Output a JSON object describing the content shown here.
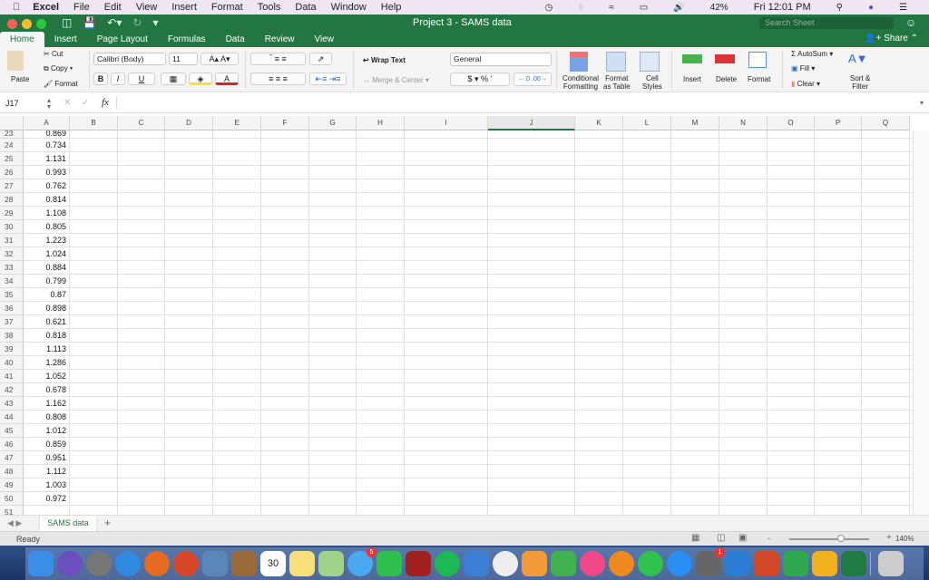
{
  "menubar": {
    "app": "Excel",
    "items": [
      "File",
      "Edit",
      "View",
      "Insert",
      "Format",
      "Tools",
      "Data",
      "Window",
      "Help"
    ],
    "battery": "42%",
    "clock": "Fri 12:01 PM"
  },
  "window": {
    "title": "Project 3 - SAMS data",
    "search_placeholder": "Search Sheet",
    "share": "Share"
  },
  "tabs": [
    "Home",
    "Insert",
    "Page Layout",
    "Formulas",
    "Data",
    "Review",
    "View"
  ],
  "ribbon": {
    "paste": "Paste",
    "cut": "Cut",
    "copy": "Copy",
    "format_painter": "Format",
    "font": "Calibri (Body)",
    "size": "11",
    "bold": "B",
    "italic": "I",
    "underline": "U",
    "wrap": "Wrap Text",
    "merge": "Merge & Center",
    "number_format": "General",
    "currency": "$",
    "percent": "%",
    "comma": "’",
    "cond": [
      "Conditional",
      "Formatting"
    ],
    "fmt_table": [
      "Format",
      "as Table"
    ],
    "cell_styles": [
      "Cell",
      "Styles"
    ],
    "insert": "Insert",
    "delete": "Delete",
    "format": "Format",
    "autosum": "AutoSum",
    "fill": "Fill",
    "clear": "Clear",
    "sort": [
      "Sort &",
      "Filter"
    ]
  },
  "formula_bar": {
    "name_box": "J17",
    "fx": "fx",
    "value": ""
  },
  "grid": {
    "columns": [
      "A",
      "B",
      "C",
      "D",
      "E",
      "F",
      "G",
      "H",
      "I",
      "J",
      "K",
      "L",
      "M",
      "N",
      "O",
      "P",
      "Q"
    ],
    "selected_column": "J",
    "rows": [
      {
        "n": "23",
        "a": "0.869"
      },
      {
        "n": "24",
        "a": "0.734"
      },
      {
        "n": "25",
        "a": "1.131"
      },
      {
        "n": "26",
        "a": "0.993"
      },
      {
        "n": "27",
        "a": "0.762"
      },
      {
        "n": "28",
        "a": "0.814"
      },
      {
        "n": "29",
        "a": "1.108"
      },
      {
        "n": "30",
        "a": "0.805"
      },
      {
        "n": "31",
        "a": "1.223"
      },
      {
        "n": "32",
        "a": "1.024"
      },
      {
        "n": "33",
        "a": "0.884"
      },
      {
        "n": "34",
        "a": "0.799"
      },
      {
        "n": "35",
        "a": "0.87"
      },
      {
        "n": "36",
        "a": "0.898"
      },
      {
        "n": "37",
        "a": "0.621"
      },
      {
        "n": "38",
        "a": "0.818"
      },
      {
        "n": "39",
        "a": "1.113"
      },
      {
        "n": "40",
        "a": "1.286"
      },
      {
        "n": "41",
        "a": "1.052"
      },
      {
        "n": "42",
        "a": "0.678"
      },
      {
        "n": "43",
        "a": "1.162"
      },
      {
        "n": "44",
        "a": "0.808"
      },
      {
        "n": "45",
        "a": "1.012"
      },
      {
        "n": "46",
        "a": "0.859"
      },
      {
        "n": "47",
        "a": "0.951"
      },
      {
        "n": "48",
        "a": "1.112"
      },
      {
        "n": "49",
        "a": "1.003"
      },
      {
        "n": "50",
        "a": "0.972"
      },
      {
        "n": "51",
        "a": ""
      }
    ]
  },
  "sheet_tab": "SAMS data",
  "add_sheet": "+",
  "status": {
    "text": "Ready",
    "zoom": "140%",
    "minus": "-",
    "plus": "+"
  },
  "dock": {
    "calendar_day": "30",
    "badge_messages": "5",
    "badge_prefs": "1",
    "icons": [
      {
        "name": "finder",
        "color": "#3a8ee6"
      },
      {
        "name": "siri",
        "color": "#6b4fbf"
      },
      {
        "name": "launchpad",
        "color": "#777"
      },
      {
        "name": "safari",
        "color": "#2f8ae0"
      },
      {
        "name": "firefox",
        "color": "#e66a1f"
      },
      {
        "name": "chrome",
        "color": "#d9472b"
      },
      {
        "name": "preview",
        "color": "#5a86b8"
      },
      {
        "name": "contacts",
        "color": "#9a6a3a"
      },
      {
        "name": "calendar",
        "color": "#fff"
      },
      {
        "name": "notes",
        "color": "#f7e07a"
      },
      {
        "name": "maps",
        "color": "#9fd38a"
      },
      {
        "name": "messages",
        "color": "#4aa8f0"
      },
      {
        "name": "facetime",
        "color": "#2fbf4f"
      },
      {
        "name": "photo-booth",
        "color": "#a02020"
      },
      {
        "name": "spotify",
        "color": "#1db954"
      },
      {
        "name": "keynote",
        "color": "#3b7fd4"
      },
      {
        "name": "photos",
        "color": "#eee"
      },
      {
        "name": "pages",
        "color": "#f29a3a"
      },
      {
        "name": "numbers",
        "color": "#3fb24f"
      },
      {
        "name": "itunes",
        "color": "#f04a8a"
      },
      {
        "name": "ibooks",
        "color": "#f08a20"
      },
      {
        "name": "whatsapp",
        "color": "#2fc24f"
      },
      {
        "name": "app-store",
        "color": "#2a8ef0"
      },
      {
        "name": "system-preferences",
        "color": "#666"
      },
      {
        "name": "word",
        "color": "#2b7cd3"
      },
      {
        "name": "powerpoint",
        "color": "#d24726"
      },
      {
        "name": "excel-x",
        "color": "#2fa84f"
      },
      {
        "name": "outlook",
        "color": "#f0b020"
      },
      {
        "name": "excel",
        "color": "#1f7a44"
      },
      {
        "name": "trash",
        "color": "#ccc"
      }
    ]
  }
}
